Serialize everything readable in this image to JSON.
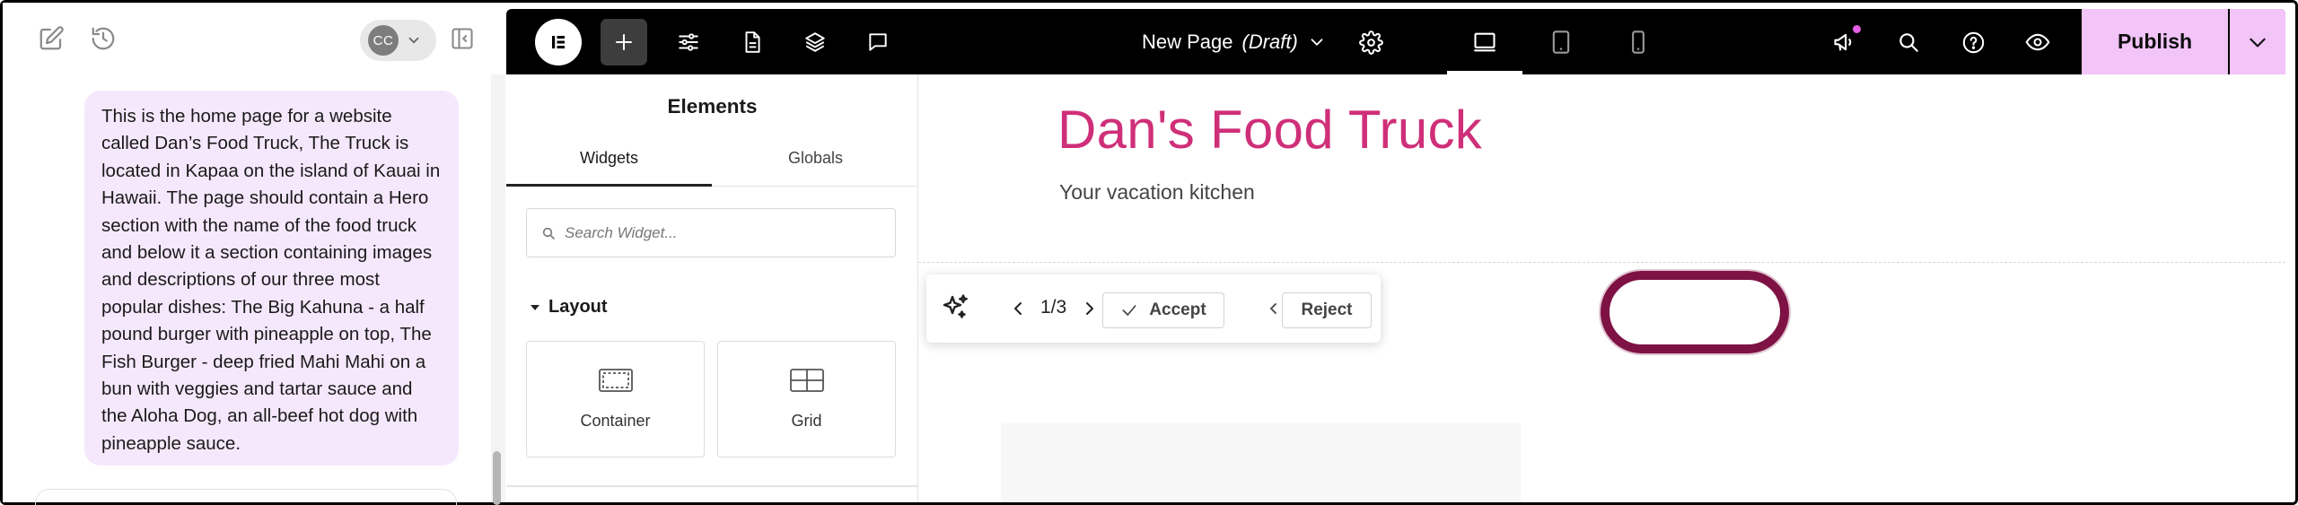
{
  "chat": {
    "user_message": "This is the home page for a website called Dan’s Food Truck, The Truck is located in Kapaa on the island of Kauai in Hawaii. The page should contain a Hero section with the name of the food truck and below it a section containing images and descriptions of our three most popular dishes: The Big Kahuna - a half pound burger with pineapple on top, The Fish Burger - deep fried Mahi Mahi on a bun with veggies and tartar sauce and the Aloha Dog, an all-beef hot dog with pineapple sauce.",
    "avatar_initials": "CC",
    "bubble_color": "#f6e8fc"
  },
  "topbar": {
    "page_name": "New Page",
    "page_status": "(Draft)",
    "publish_label": "Publish",
    "publish_color": "#f2c4f7",
    "icons": [
      "elementor-logo-icon",
      "plus-icon",
      "sliders-icon",
      "page-icon",
      "layers-icon",
      "comment-icon",
      "settings-gear-icon",
      "desktop-icon",
      "tablet-icon",
      "mobile-icon",
      "megaphone-icon",
      "search-icon",
      "help-icon",
      "preview-eye-icon",
      "chevron-down-icon"
    ]
  },
  "elements_panel": {
    "title": "Elements",
    "tabs": [
      "Widgets",
      "Globals"
    ],
    "active_tab": "Widgets",
    "search_placeholder": "Search Widget...",
    "section_label": "Layout",
    "widgets": [
      {
        "label": "Container",
        "icon": "container-icon"
      },
      {
        "label": "Grid",
        "icon": "grid-icon"
      }
    ]
  },
  "canvas": {
    "hero_title": "Dan's Food Truck",
    "hero_subtitle": "Your vacation kitchen",
    "title_color": "#cf2f79"
  },
  "ai_toolbar": {
    "counter": "1/3",
    "accept_label": "Accept",
    "reject_label": "Reject",
    "highlight_color": "#7e1244"
  }
}
